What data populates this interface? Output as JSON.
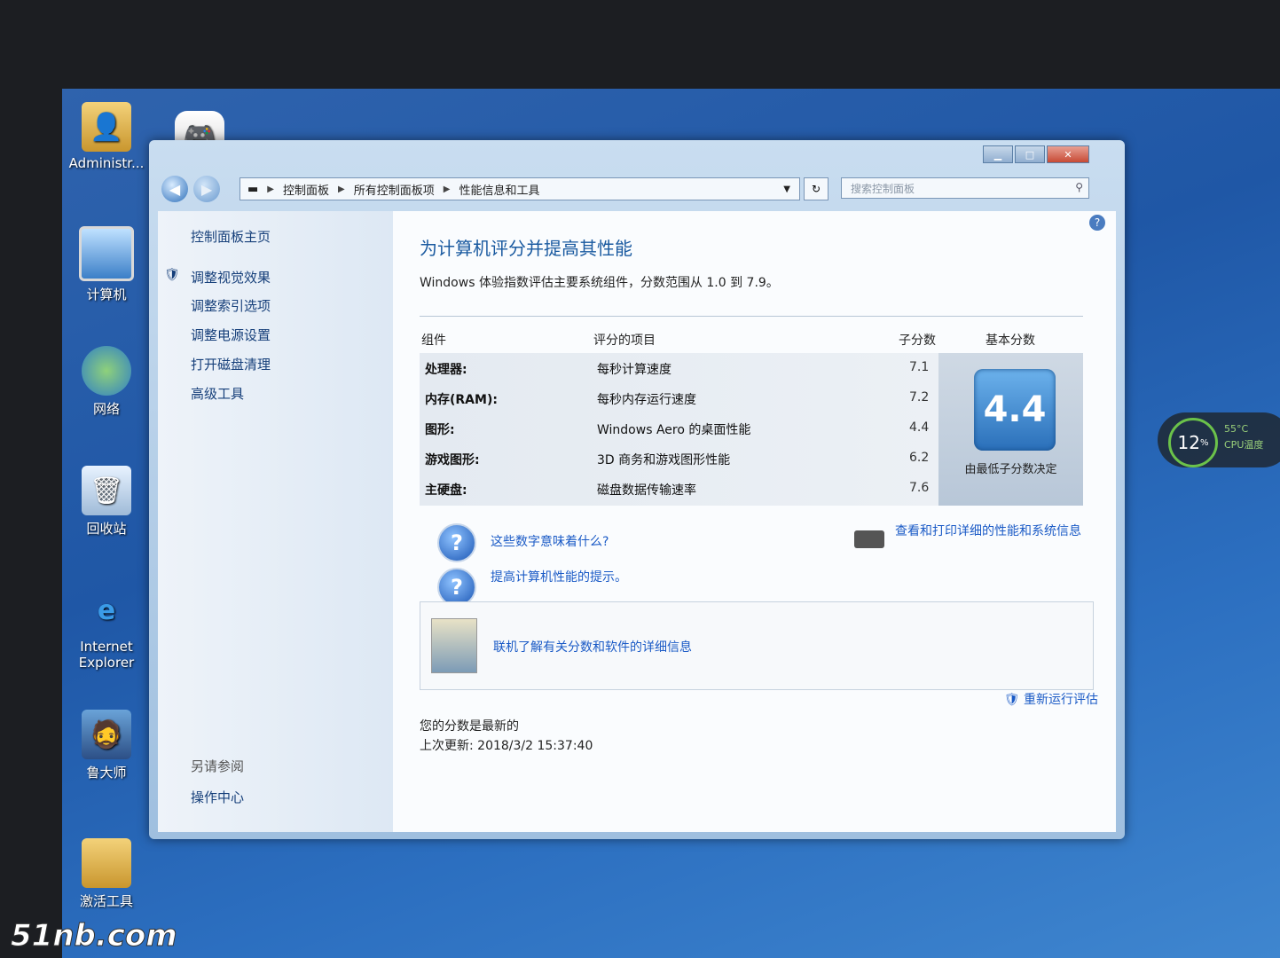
{
  "desktop": {
    "icons": [
      {
        "label": "Administr...",
        "icon": "user-folder-icon"
      },
      {
        "label": "计算机",
        "icon": "computer-icon"
      },
      {
        "label": "网络",
        "icon": "network-icon"
      },
      {
        "label": "回收站",
        "icon": "recycle-bin-icon"
      },
      {
        "label": "Internet Explorer",
        "icon": "ie-icon"
      },
      {
        "label": "鲁大师",
        "icon": "ludashi-icon"
      },
      {
        "label": "激活工具",
        "icon": "folder-icon"
      }
    ]
  },
  "gadget": {
    "cpu_percent": "12",
    "percent_sign": "%",
    "temp": "55°C",
    "label": "CPU温度"
  },
  "window": {
    "breadcrumb": [
      "控制面板",
      "所有控制面板项",
      "性能信息和工具"
    ],
    "search_placeholder": "搜索控制面板",
    "sidebar": {
      "home": "控制面板主页",
      "items": [
        "调整视觉效果",
        "调整索引选项",
        "调整电源设置",
        "打开磁盘清理",
        "高级工具"
      ],
      "see_also": "另请参阅",
      "action_center": "操作中心"
    },
    "heading": "为计算机评分并提高其性能",
    "description": "Windows 体验指数评估主要系统组件，分数范围从 1.0 到 7.9。",
    "table": {
      "headers": {
        "component": "组件",
        "rated": "评分的项目",
        "subscore": "子分数",
        "base": "基本分数"
      },
      "rows": [
        {
          "component": "处理器:",
          "item": "每秒计算速度",
          "score": "7.1"
        },
        {
          "component": "内存(RAM):",
          "item": "每秒内存运行速度",
          "score": "7.2"
        },
        {
          "component": "图形:",
          "item": "Windows Aero 的桌面性能",
          "score": "4.4"
        },
        {
          "component": "游戏图形:",
          "item": "3D 商务和游戏图形性能",
          "score": "6.2"
        },
        {
          "component": "主硬盘:",
          "item": "磁盘数据传输速率",
          "score": "7.6"
        }
      ],
      "base_score": "4.4",
      "base_note": "由最低子分数决定"
    },
    "links": {
      "what_mean": "这些数字意味着什么?",
      "tips": "提高计算机性能的提示。",
      "details": "查看和打印详细的性能和系统信息",
      "online": "联机了解有关分数和软件的详细信息",
      "rerun": "重新运行评估"
    },
    "status": {
      "line1": "您的分数是最新的",
      "line2": "上次更新: 2018/3/2 15:37:40"
    }
  },
  "watermark": "51nb.com"
}
